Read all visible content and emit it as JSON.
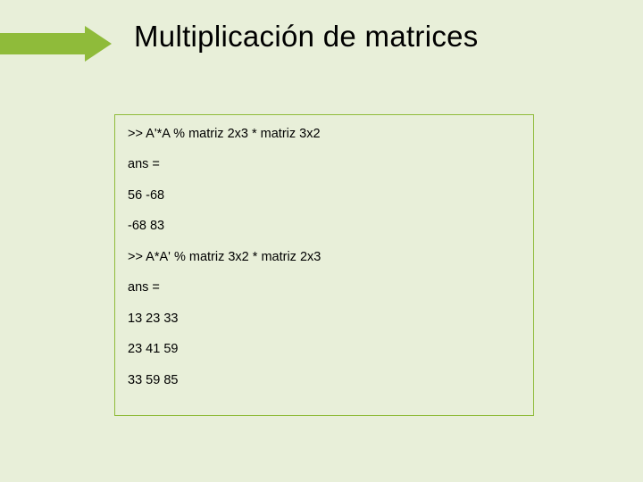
{
  "title": "Multiplicación de matrices",
  "lines": [
    ">> A'*A % matriz 2x3 * matriz 3x2",
    "ans =",
    "56 -68",
    "-68 83",
    ">> A*A' % matriz 3x2 * matriz 2x3",
    "ans =",
    "13 23 33",
    "23 41 59",
    "33 59 85"
  ]
}
